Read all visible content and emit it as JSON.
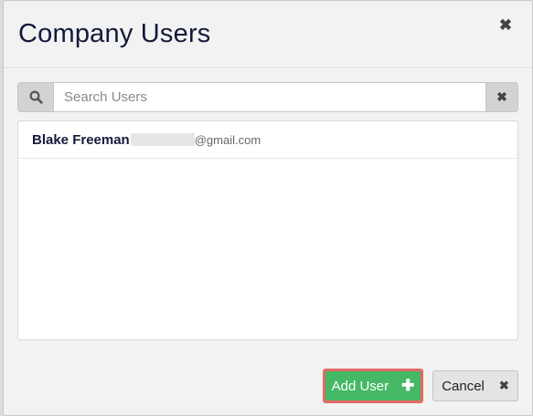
{
  "modal": {
    "title": "Company Users",
    "close_icon": "close-icon"
  },
  "search": {
    "placeholder": "Search Users",
    "value": "",
    "search_icon": "search-icon",
    "clear_icon": "clear-icon"
  },
  "users": [
    {
      "name": "Blake Freeman",
      "email_domain": "@gmail.com"
    }
  ],
  "buttons": {
    "add_user_label": "Add User",
    "add_user_icon": "plus-icon",
    "cancel_label": "Cancel",
    "cancel_icon": "times-icon"
  },
  "colors": {
    "add_button": "#45b865",
    "add_button_highlight": "#e46a66",
    "title_text": "#141a3a"
  }
}
